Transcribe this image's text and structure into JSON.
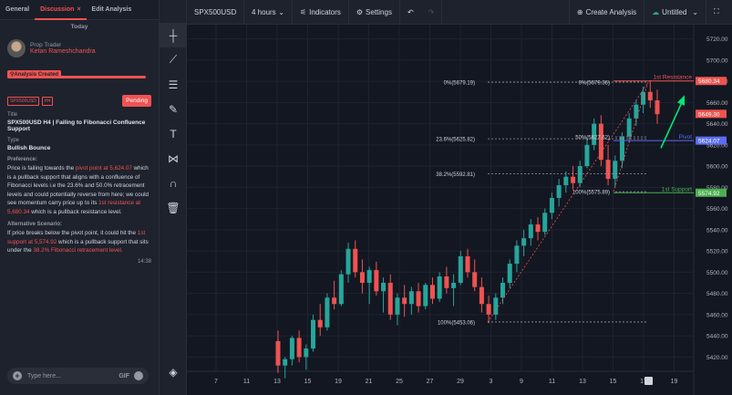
{
  "tabs": [
    {
      "label": "General"
    },
    {
      "label": "Discussion",
      "close": "×"
    },
    {
      "label": "Edit Analysis"
    }
  ],
  "day_label": "Today",
  "author": {
    "role": "Prop Trader",
    "name": "Ketan Rameshchandra"
  },
  "analysis_created": "Analysis Created",
  "badges": [
    "SPX500USD",
    "H4"
  ],
  "status": "Pending",
  "title_label": "Title",
  "title": "SPX500USD H4 | Failing to Fibonacci Confluence Support",
  "type_label": "Type",
  "type": "Bullish Bounce",
  "preference_label": "Preference:",
  "preference": {
    "p1": "Price is failing towards the ",
    "h1": "pivot point at 5,624.07",
    "p2": " which is a pullback support that aligns with a confluence of Fibonacci levels i.e the 23.6% and 50.0% retracement levels and could potentially reverse from here; we could see momentum carry price up to its ",
    "h2": "1st resistance at 5,680.34",
    "p3": " which is a pullback resistance level."
  },
  "alt_label": "Alternative Scenario:",
  "alternative": {
    "p1": "If price breaks below the pivot point, it could hit the ",
    "h1": "1st support at 5,574.92",
    "p2": " which is a pullback support that sits under the ",
    "h2": "38.2% Fibonacci retracement level."
  },
  "message_time": "14:38",
  "chat": {
    "placeholder": "Type here...",
    "gif": "GIF"
  },
  "toolbar": {
    "symbol": "SPX500USD",
    "interval": "4 hours",
    "indicators": "Indicators",
    "settings": "Settings",
    "create_analysis": "Create Analysis",
    "layout_name": "Untitled"
  },
  "colors": {
    "up": "#26a69a",
    "down": "#ef5350",
    "accent": "#ef5350",
    "pivot": "#5b6cf0",
    "support": "#4caf50"
  },
  "chart_data": {
    "type": "candlestick",
    "ylim": [
      5410,
      5730
    ],
    "y_ticks": [
      "5720.00",
      "5700.00",
      "5680.00",
      "5660.00",
      "5640.00",
      "5620.00",
      "5600.00",
      "5580.00",
      "5560.00",
      "5540.00",
      "5520.00",
      "5500.00",
      "5480.00",
      "5460.00",
      "5440.00",
      "5420.00"
    ],
    "x_ticks": [
      "7",
      "11",
      "13",
      "15",
      "19",
      "21",
      "25",
      "27",
      "29",
      "3",
      "9",
      "11",
      "13",
      "15",
      "17",
      "19"
    ],
    "fib_levels": [
      {
        "label": "0%(5679.19)",
        "value": 5679.19
      },
      {
        "label": "23.6%(5625.82)",
        "value": 5625.82
      },
      {
        "label": "38.2%(5592.81)",
        "value": 5592.81
      },
      {
        "label": "100%(5453.06)",
        "value": 5453.06
      }
    ],
    "fib2_levels": [
      {
        "label": "0%(5679.36)",
        "value": 5679.36
      },
      {
        "label": "50%(5627.62)",
        "value": 5627.62
      },
      {
        "label": "100%(5575.89)",
        "value": 5575.89
      }
    ],
    "levels": [
      {
        "name": "1st Resistance",
        "value": 5680.34,
        "price": "5680.34"
      },
      {
        "name": "Pivot",
        "value": 5624.07,
        "price": "5624.07"
      },
      {
        "name": "1st Support",
        "value": 5574.92,
        "price": "5574.92"
      }
    ],
    "last_price": "5649.30",
    "last_value": 5649.3,
    "candles": [
      [
        5435,
        5445,
        5405,
        5412
      ],
      [
        5412,
        5420,
        5400,
        5418
      ],
      [
        5418,
        5440,
        5412,
        5438
      ],
      [
        5438,
        5445,
        5415,
        5420
      ],
      [
        5420,
        5432,
        5408,
        5428
      ],
      [
        5428,
        5460,
        5425,
        5455
      ],
      [
        5455,
        5470,
        5440,
        5448
      ],
      [
        5448,
        5480,
        5445,
        5476
      ],
      [
        5476,
        5492,
        5465,
        5470
      ],
      [
        5470,
        5502,
        5468,
        5498
      ],
      [
        5498,
        5528,
        5490,
        5522
      ],
      [
        5522,
        5530,
        5495,
        5500
      ],
      [
        5500,
        5512,
        5480,
        5490
      ],
      [
        5490,
        5505,
        5470,
        5502
      ],
      [
        5502,
        5510,
        5478,
        5482
      ],
      [
        5482,
        5495,
        5462,
        5490
      ],
      [
        5490,
        5498,
        5455,
        5460
      ],
      [
        5460,
        5480,
        5450,
        5476
      ],
      [
        5476,
        5488,
        5458,
        5470
      ],
      [
        5470,
        5486,
        5460,
        5482
      ],
      [
        5482,
        5490,
        5462,
        5468
      ],
      [
        5468,
        5490,
        5465,
        5488
      ],
      [
        5488,
        5495,
        5470,
        5475
      ],
      [
        5475,
        5500,
        5472,
        5496
      ],
      [
        5496,
        5505,
        5480,
        5485
      ],
      [
        5485,
        5498,
        5468,
        5490
      ],
      [
        5490,
        5520,
        5488,
        5515
      ],
      [
        5515,
        5522,
        5495,
        5500
      ],
      [
        5500,
        5512,
        5482,
        5486
      ],
      [
        5486,
        5495,
        5462,
        5470
      ],
      [
        5470,
        5478,
        5452,
        5460
      ],
      [
        5460,
        5480,
        5455,
        5476
      ],
      [
        5476,
        5495,
        5470,
        5490
      ],
      [
        5490,
        5512,
        5485,
        5508
      ],
      [
        5508,
        5530,
        5500,
        5525
      ],
      [
        5525,
        5540,
        5515,
        5532
      ],
      [
        5532,
        5550,
        5525,
        5545
      ],
      [
        5545,
        5552,
        5530,
        5538
      ],
      [
        5538,
        5560,
        5535,
        5556
      ],
      [
        5556,
        5575,
        5550,
        5570
      ],
      [
        5570,
        5588,
        5562,
        5582
      ],
      [
        5582,
        5595,
        5575,
        5590
      ],
      [
        5590,
        5600,
        5578,
        5584
      ],
      [
        5584,
        5605,
        5580,
        5600
      ],
      [
        5600,
        5625,
        5598,
        5620
      ],
      [
        5620,
        5645,
        5615,
        5640
      ],
      [
        5640,
        5648,
        5600,
        5606
      ],
      [
        5606,
        5620,
        5582,
        5588
      ],
      [
        5588,
        5610,
        5580,
        5605
      ],
      [
        5605,
        5632,
        5598,
        5628
      ],
      [
        5628,
        5650,
        5622,
        5645
      ],
      [
        5645,
        5662,
        5638,
        5658
      ],
      [
        5658,
        5675,
        5650,
        5670
      ],
      [
        5670,
        5681,
        5655,
        5662
      ],
      [
        5662,
        5672,
        5640,
        5649
      ]
    ]
  }
}
